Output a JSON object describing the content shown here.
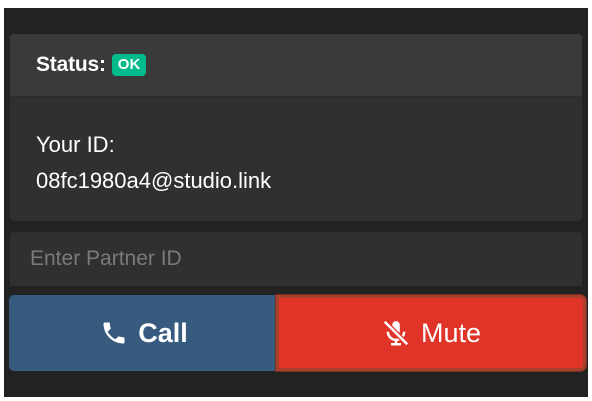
{
  "status": {
    "label": "Status:",
    "badge": "OK",
    "badge_color": "#00bc8c"
  },
  "identity": {
    "label": "Your ID:",
    "value": "08fc1980a4@studio.link"
  },
  "partner": {
    "placeholder": "Enter Partner ID",
    "value": ""
  },
  "actions": {
    "call_label": "Call",
    "call_icon": "phone-icon",
    "call_color": "#375a7f",
    "mute_label": "Mute",
    "mute_icon": "microphone-slash-icon",
    "mute_color": "#e03428"
  }
}
